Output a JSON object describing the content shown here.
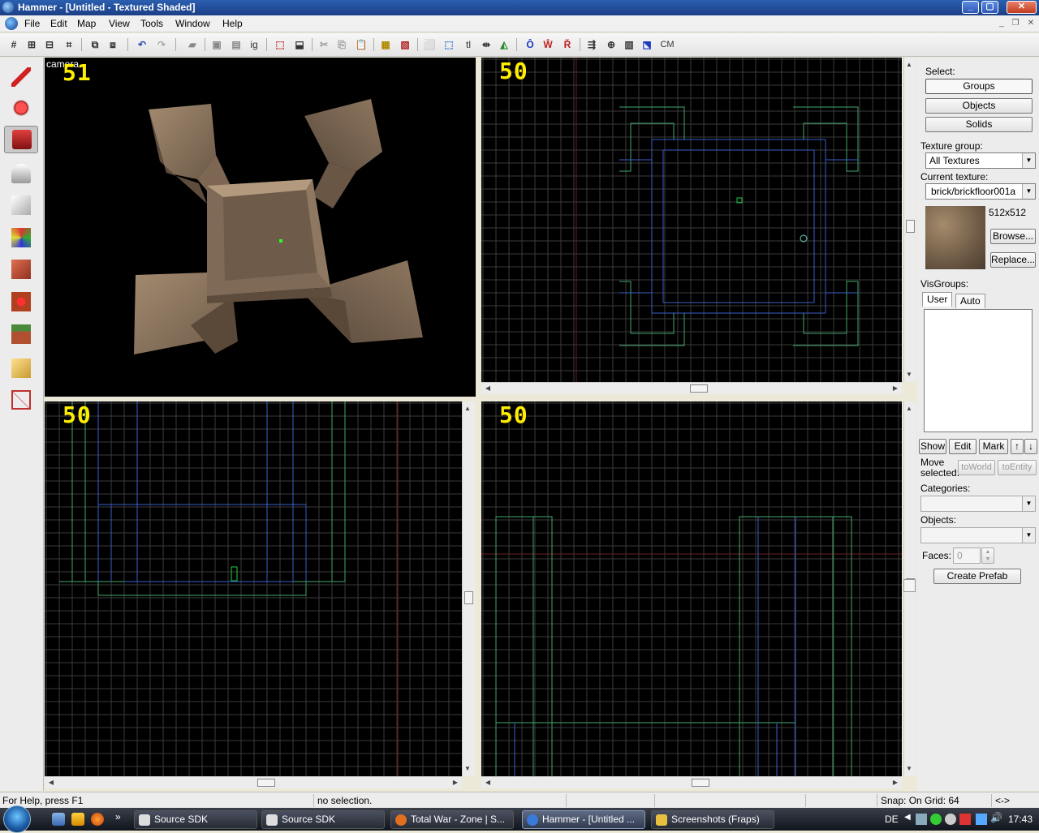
{
  "window": {
    "title": "Hammer - [Untitled - Textured Shaded]"
  },
  "menubar": {
    "items": [
      "File",
      "Edit",
      "Map",
      "View",
      "Tools",
      "Window",
      "Help"
    ]
  },
  "toolbar": {
    "cm_label": "CM",
    "ig_label": "ig",
    "tl_label": "tl"
  },
  "tools": [
    "selection-tool",
    "magnify-tool",
    "camera-tool",
    "entity-tool",
    "block-tool",
    "texture-application-tool",
    "apply-current-texture-tool",
    "decal-tool",
    "overlay-tool",
    "clipping-tool",
    "vertex-manipulation-tool"
  ],
  "viewports": {
    "camera": {
      "label": "camera",
      "zoom": "51"
    },
    "top": {
      "zoom": "50"
    },
    "front": {
      "zoom": "50"
    },
    "side": {
      "zoom": "50"
    }
  },
  "right_panel": {
    "select_label": "Select:",
    "select_buttons": [
      "Groups",
      "Objects",
      "Solids"
    ],
    "texture_group_label": "Texture group:",
    "texture_group_value": "All Textures",
    "current_texture_label": "Current texture:",
    "current_texture_value": "brick/brickfloor001a",
    "texture_size": "512x512",
    "browse_label": "Browse...",
    "replace_label": "Replace...",
    "visgroups_label": "VisGroups:",
    "tabs": [
      "User",
      "Auto"
    ],
    "vis_buttons": [
      "Show",
      "Edit",
      "Mark"
    ],
    "move_selected_label": "Move selected:",
    "to_world_label": "toWorld",
    "to_entity_label": "toEntity",
    "categories_label": "Categories:",
    "objects_label": "Objects:",
    "faces_label": "Faces:",
    "faces_value": "0",
    "create_prefab_label": "Create Prefab"
  },
  "statusbar": {
    "help": "For Help, press F1",
    "selection": "no selection.",
    "snap": "Snap: On Grid: 64",
    "extra": "<->"
  },
  "taskbar": {
    "tasks": [
      "Source SDK",
      "Source SDK",
      "Total War - Zone | S...",
      "Hammer - [Untitled ...",
      "Screenshots (Fraps)"
    ],
    "language": "DE",
    "clock": "17:43"
  },
  "colors": {
    "grid": "#3a3a3a",
    "axis": "#6b1f1f",
    "brush_blue": "#3a5fc8",
    "brush_green": "#3fa86a",
    "zoom_label": "#ffee00"
  }
}
